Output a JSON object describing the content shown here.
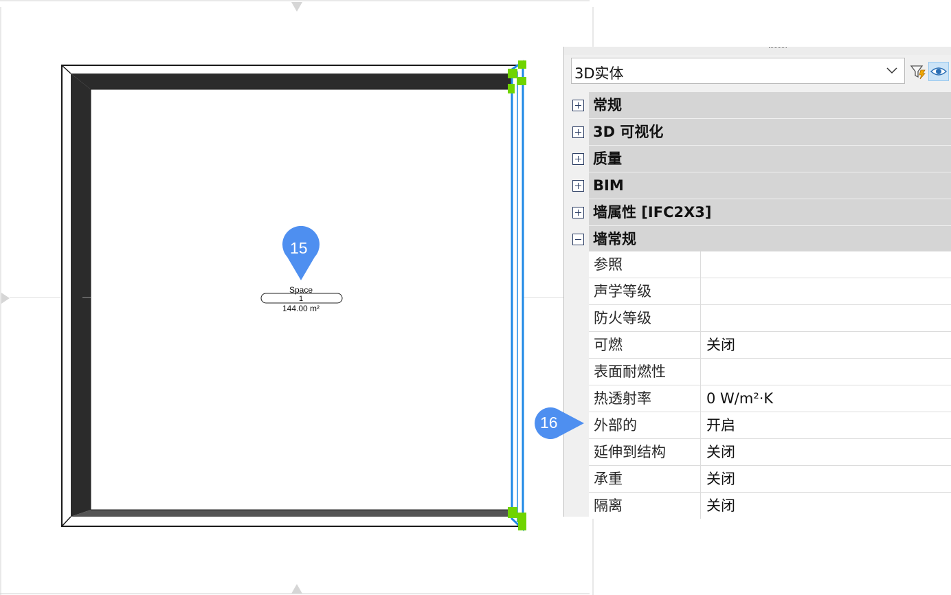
{
  "canvas": {
    "space_label": {
      "name": "Space",
      "number": "1",
      "area": "144.00 m²"
    }
  },
  "callouts": [
    {
      "number": "15",
      "color": "#4e8ff0"
    },
    {
      "number": "16",
      "color": "#4e8ff0"
    }
  ],
  "properties_panel": {
    "type_select": {
      "value": "3D实体",
      "icon": "chevron-down-icon"
    },
    "toolbar": [
      {
        "icon": "quick-select-filter-icon"
      },
      {
        "icon": "eye-icon",
        "active": true
      }
    ],
    "categories": [
      {
        "label": "常规",
        "expanded": false
      },
      {
        "label": "3D 可视化",
        "expanded": false
      },
      {
        "label": "质量",
        "expanded": false
      },
      {
        "label": "BIM",
        "expanded": false
      },
      {
        "label": "墙属性 [IFC2X3]",
        "expanded": false
      },
      {
        "label": "墙常规",
        "expanded": true
      }
    ],
    "wall_general_properties": [
      {
        "name": "参照",
        "value": ""
      },
      {
        "name": "声学等级",
        "value": ""
      },
      {
        "name": "防火等级",
        "value": ""
      },
      {
        "name": "可燃",
        "value": "关闭"
      },
      {
        "name": "表面耐燃性",
        "value": ""
      },
      {
        "name": "热透射率",
        "value": "0 W/m²·K"
      },
      {
        "name": "外部的",
        "value": "开启"
      },
      {
        "name": "延伸到结构",
        "value": "关闭"
      },
      {
        "name": "承重",
        "value": "关闭"
      },
      {
        "name": "隔离",
        "value": "关闭"
      }
    ]
  },
  "colors": {
    "selection": "#1e88e5",
    "grip": "#6fd400",
    "wall_fill": "#2b2b2b",
    "category_bg": "#d5d5d5"
  }
}
